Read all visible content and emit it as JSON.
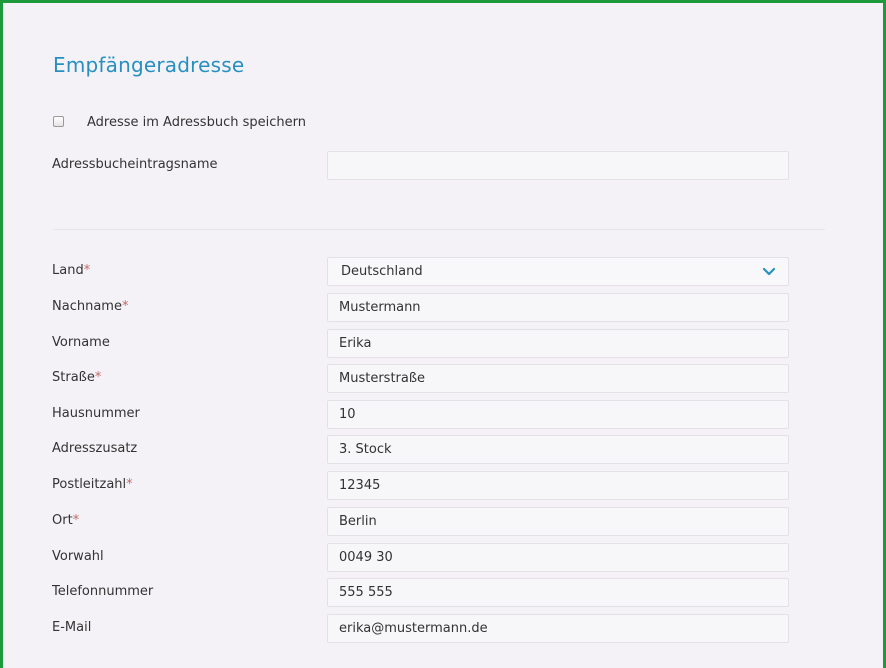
{
  "section": {
    "title": "Empfängeradresse",
    "save_checkbox_label": "Adresse im Adressbuch speichern",
    "entry_name_label": "Adressbucheintragsname",
    "entry_name_value": ""
  },
  "fields": {
    "land": {
      "label": "Land",
      "required": "*",
      "value": "Deutschland"
    },
    "nachname": {
      "label": "Nachname",
      "required": "*",
      "value": "Mustermann"
    },
    "vorname": {
      "label": "Vorname",
      "required": "",
      "value": "Erika"
    },
    "strasse": {
      "label": "Straße",
      "required": "*",
      "value": "Musterstraße"
    },
    "hausnummer": {
      "label": "Hausnummer",
      "required": "",
      "value": "10"
    },
    "adresszusatz": {
      "label": "Adresszusatz",
      "required": "",
      "value": "3. Stock"
    },
    "postleitzahl": {
      "label": "Postleitzahl",
      "required": "*",
      "value": "12345"
    },
    "ort": {
      "label": "Ort",
      "required": "*",
      "value": "Berlin"
    },
    "vorwahl": {
      "label": "Vorwahl",
      "required": "",
      "value": "0049 30"
    },
    "telefonnummer": {
      "label": "Telefonnummer",
      "required": "",
      "value": "555 555"
    },
    "email": {
      "label": "E-Mail",
      "required": "",
      "value": "erika@mustermann.de"
    }
  },
  "icons": {
    "select_arrow": "chevron-down-icon"
  },
  "colors": {
    "title": "#2790c0",
    "chevron": "#2790c0",
    "required_marker": "#c06a6a",
    "frame_border": "#1e9a3c"
  }
}
